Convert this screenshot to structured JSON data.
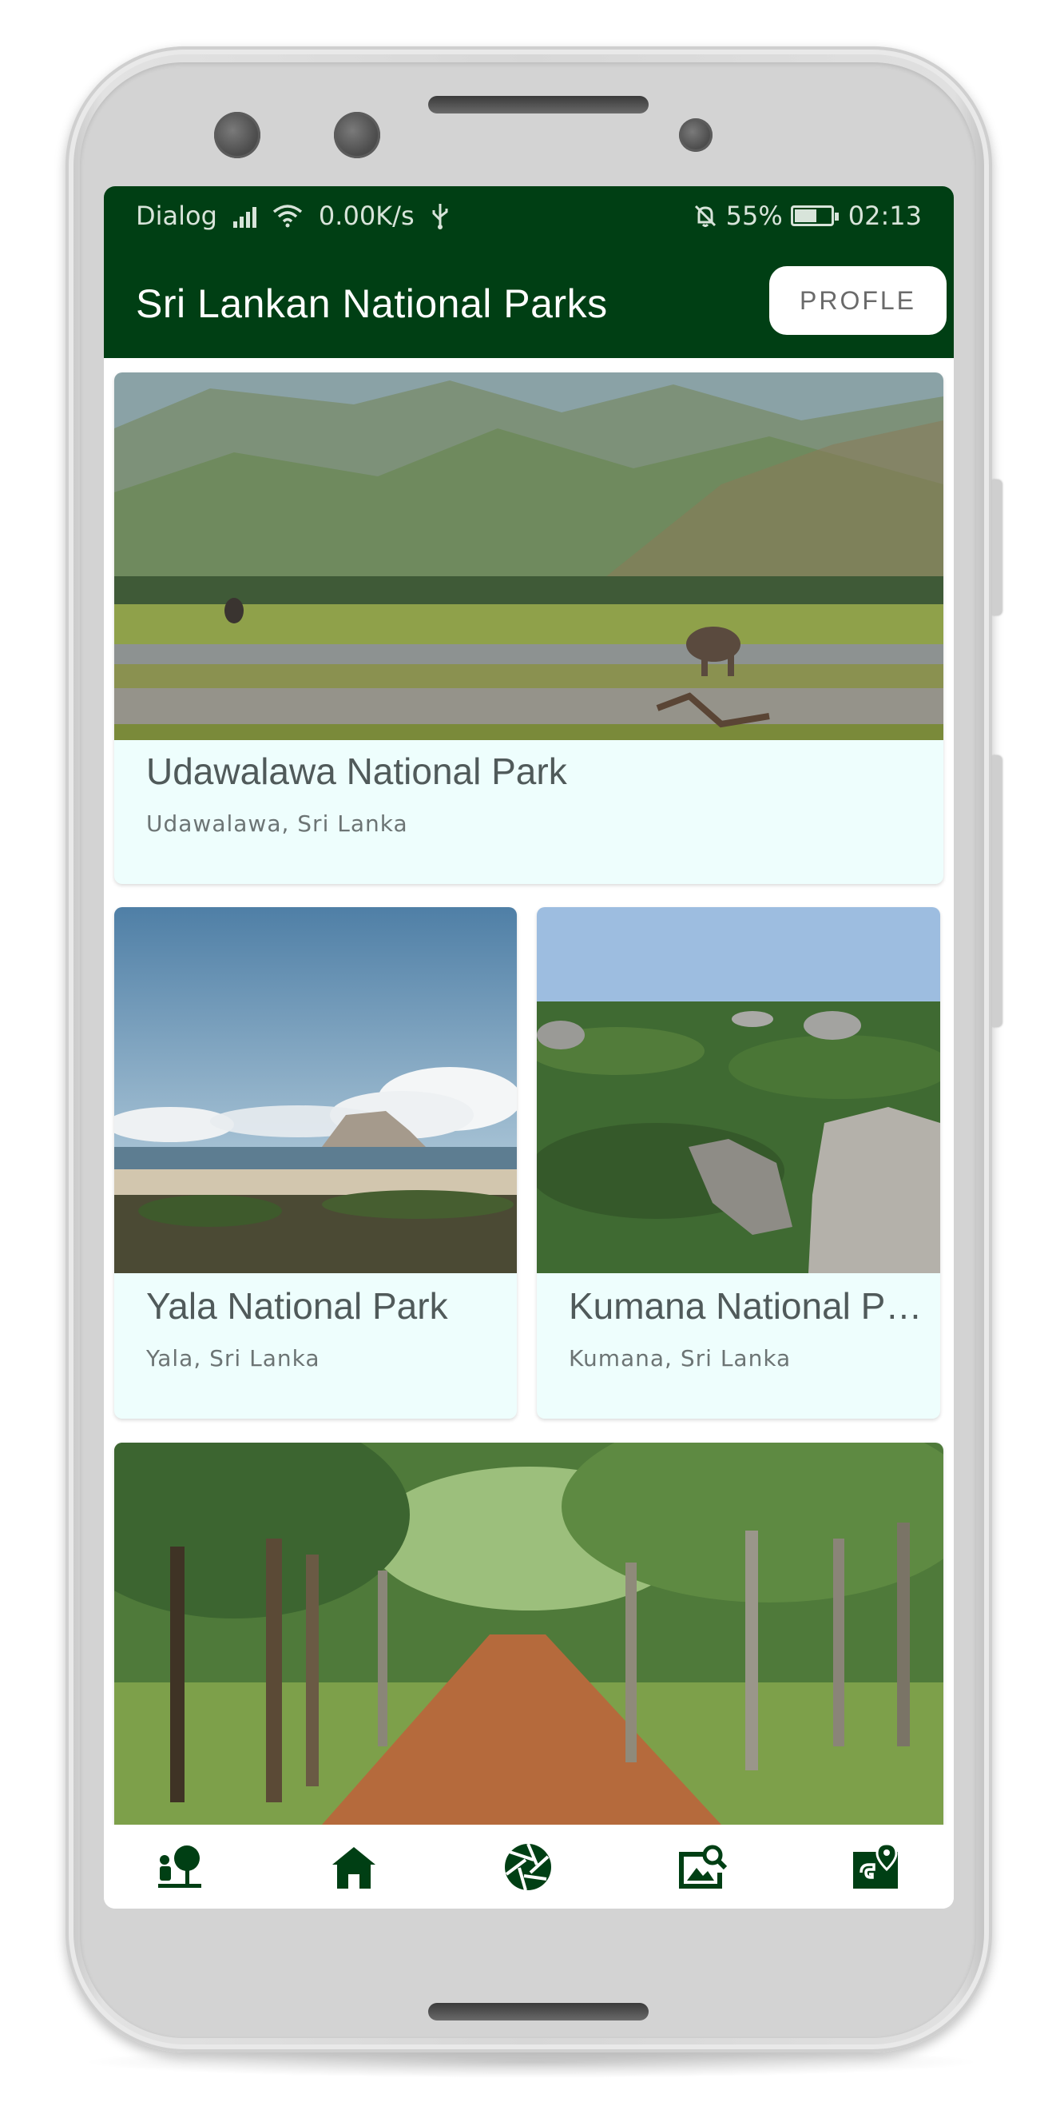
{
  "status_bar": {
    "carrier": "Dialog",
    "net_speed": "0.00K/s",
    "battery_percent": "55%",
    "time": "02:13"
  },
  "app_bar": {
    "title": "Sri Lankan National Parks",
    "profile_label": "PROFLE"
  },
  "parks": [
    {
      "name": "Udawalawa National Park",
      "location": "Udawalawa,  Sri Lanka"
    },
    {
      "name": "Yala National Park",
      "location": "Yala, Sri Lanka"
    },
    {
      "name": "Kumana National Park",
      "location": "Kumana, Sri Lanka"
    },
    {
      "name": "",
      "location": ""
    }
  ],
  "bottom_nav": {
    "items": [
      "nature-person-icon",
      "home-icon",
      "camera-shutter-icon",
      "image-search-icon",
      "map-location-icon"
    ]
  },
  "colors": {
    "app_bar": "#003f14",
    "card_background": "#eefefd",
    "nav_icon": "#003f14"
  }
}
